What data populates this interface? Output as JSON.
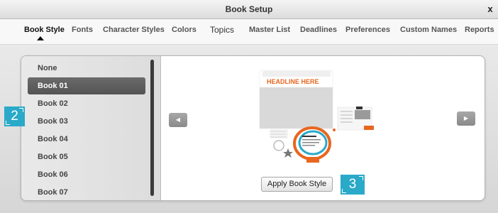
{
  "window": {
    "title": "Book Setup",
    "close_label": "x"
  },
  "tabs": [
    {
      "label": "Book Style",
      "active": true
    },
    {
      "label": "Fonts"
    },
    {
      "label": "Character Styles"
    },
    {
      "label": "Colors"
    },
    {
      "label": "Topics"
    },
    {
      "label": "Master List"
    },
    {
      "label": "Deadlines"
    },
    {
      "label": "Preferences"
    },
    {
      "label": "Custom Names"
    },
    {
      "label": "Reports"
    }
  ],
  "styles_list": {
    "items": [
      "None",
      "Book 01",
      "Book 02",
      "Book 03",
      "Book 04",
      "Book 05",
      "Book 06",
      "Book 07"
    ],
    "selected": "Book 01"
  },
  "preview": {
    "headline_text": "HEADLINE HERE",
    "prev_icon": "left-arrow-icon",
    "next_icon": "right-arrow-icon",
    "prev_glyph": "◀",
    "next_glyph": "▶"
  },
  "apply_button": {
    "label": "Apply Book Style"
  },
  "callouts": [
    {
      "number": "2"
    },
    {
      "number": "3"
    }
  ],
  "colors": {
    "accent_orange": "#e8661f",
    "accent_teal": "#2aa9c9",
    "selected_item": "#5c5c5c"
  }
}
